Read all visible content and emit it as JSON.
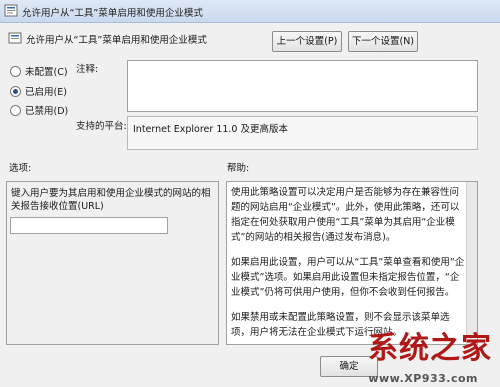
{
  "window": {
    "title": "允许用户从“工具”菜单启用和使用企业模式",
    "header_title": "允许用户从“工具”菜单启用和使用企业模式"
  },
  "nav": {
    "prev_label": "上一个设置(P)",
    "next_label": "下一个设置(N)"
  },
  "state": {
    "options": [
      {
        "label": "未配置(C)",
        "checked": false
      },
      {
        "label": "已启用(E)",
        "checked": true
      },
      {
        "label": "已禁用(D)",
        "checked": false
      }
    ]
  },
  "comment": {
    "label": "注释:",
    "value": ""
  },
  "platform": {
    "label": "支持的平台:",
    "value": "Internet Explorer 11.0 及更高版本"
  },
  "options_section": {
    "label": "选项:",
    "field_text": "键入用户要为其启用和使用企业模式的网站的相关报告接收位置(URL)",
    "url_value": ""
  },
  "help_section": {
    "label": "帮助:",
    "paragraphs": [
      "使用此策略设置可以决定用户是否能够为存在兼容性问题的网站启用“企业模式”。此外，使用此策略，还可以指定在何处获取用户使用“工具”菜单为其启用“企业模式”的网站的相关报告(通过发布消息)。",
      "如果启用此设置，用户可以从“工具”菜单查看和使用“企业模式”选项。如果启用此设置但未指定报告位置，“企业模式”仍将可供用户使用，但你不会收到任何报告。",
      "如果禁用或未配置此策略设置，则不会显示该菜单选项，用户将无法在企业模式下运行网站。"
    ]
  },
  "footer": {
    "ok_label": "确定"
  },
  "watermark": {
    "main": "系统之家",
    "url": "www.XP933.com"
  }
}
